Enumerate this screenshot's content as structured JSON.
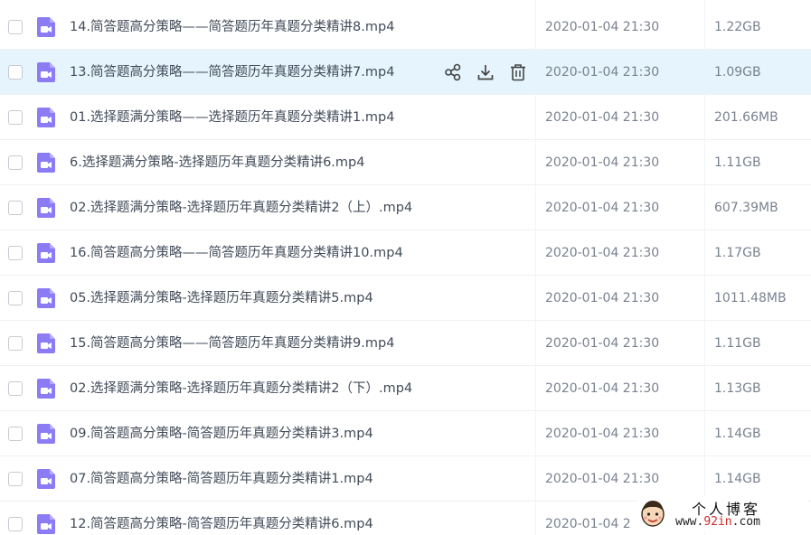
{
  "files": [
    {
      "name": "14.简答题高分策略——简答题历年真题分类精讲8.mp4",
      "date": "2020-01-04 21:30",
      "size": "1.22GB"
    },
    {
      "name": "13.简答题高分策略——简答题历年真题分类精讲7.mp4",
      "date": "2020-01-04 21:30",
      "size": "1.09GB",
      "hovered": true
    },
    {
      "name": "01.选择题满分策略——选择题历年真题分类精讲1.mp4",
      "date": "2020-01-04 21:30",
      "size": "201.66MB"
    },
    {
      "name": "6.选择题满分策略-选择题历年真题分类精讲6.mp4",
      "date": "2020-01-04 21:30",
      "size": "1.11GB"
    },
    {
      "name": "02.选择题满分策略-选择题历年真题分类精讲2（上）.mp4",
      "date": "2020-01-04 21:30",
      "size": "607.39MB"
    },
    {
      "name": "16.简答题高分策略——简答题历年真题分类精讲10.mp4",
      "date": "2020-01-04 21:30",
      "size": "1.17GB"
    },
    {
      "name": "05.选择题满分策略-选择题历年真题分类精讲5.mp4",
      "date": "2020-01-04 21:30",
      "size": "1011.48MB"
    },
    {
      "name": "15.简答题高分策略——简答题历年真题分类精讲9.mp4",
      "date": "2020-01-04 21:30",
      "size": "1.11GB"
    },
    {
      "name": "02.选择题满分策略-选择题历年真题分类精讲2（下）.mp4",
      "date": "2020-01-04 21:30",
      "size": "1.13GB"
    },
    {
      "name": "09.简答题高分策略-简答题历年真题分类精讲3.mp4",
      "date": "2020-01-04 21:30",
      "size": "1.14GB"
    },
    {
      "name": "07.简答题高分策略-简答题历年真题分类精讲1.mp4",
      "date": "2020-01-04 21:30",
      "size": "1.14GB"
    },
    {
      "name": "12.简答题高分策略-简答题历年真题分类精讲6.mp4",
      "date": "2020-01-04 2",
      "size": ""
    }
  ],
  "row_actions": {
    "share": "share-icon",
    "download": "download-icon",
    "delete": "trash-icon"
  },
  "watermark": {
    "title": "个人博客",
    "url_prefix": "www.",
    "url_accent": "92in",
    "url_suffix": ".com"
  },
  "colors": {
    "video_icon": "#8b7cf6",
    "row_hover": "#e5f4fd",
    "file_name": "#424b58",
    "meta_text": "#7a8290"
  }
}
